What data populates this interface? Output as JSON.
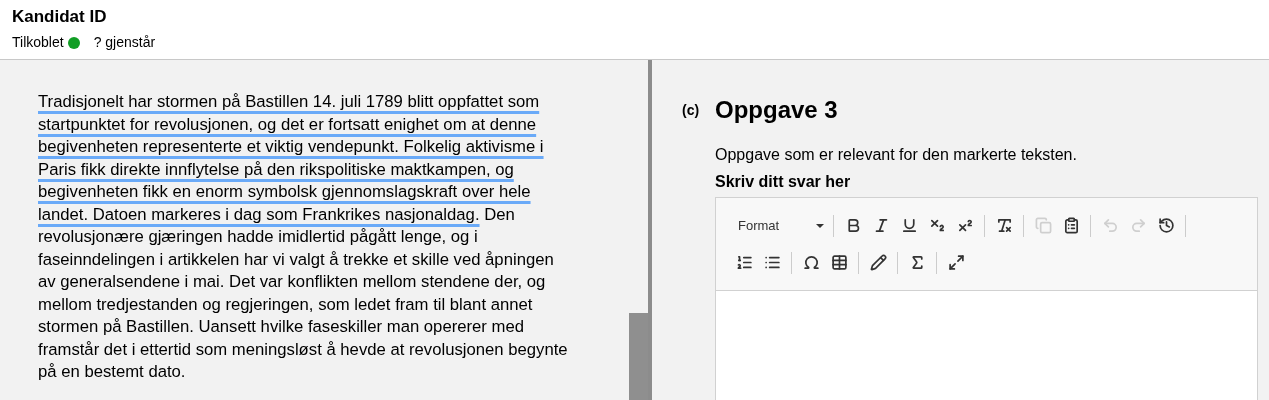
{
  "header": {
    "title": "Kandidat ID",
    "status": {
      "label": "Tilkoblet",
      "connected": true
    },
    "remaining": "? gjenstår"
  },
  "source_text": {
    "segments": [
      {
        "text": "Tradisjonelt har stormen på Bastillen 14. juli 1789 blitt oppfattet som startpunktet for revolusjonen, og det er fortsatt enighet om at denne begivenheten representerte et viktig vendepunkt. Folkelig aktivisme i Paris fikk direkte innflytelse på den rikspolitiske maktkampen, og begivenheten fikk en enorm symbolsk gjennomslagskraft over hele landet. Datoen markeres i dag som Frankrikes nasjonaldag.",
        "marked": true
      },
      {
        "text": " Den revolusjonære gjæringen hadde imidlertid pågått lenge, og i faseinndelingen i artikkelen har vi valgt å trekke et skille ved åpningen av  generalsendene i mai. Det var konflikten mellom stendene der, og mellom tredjestanden og regjeringen, som ledet fram til blant annet stormen på Bastillen. Uansett hvilke faseskiller man opererer med framstår det i ettertid som meningsløst å hevde at revolusjonen begynte på en bestemt dato.",
        "marked": false
      }
    ]
  },
  "task": {
    "number": "(c)",
    "title": "Oppgave 3",
    "description": "Oppgave som er relevant for den markerte teksten.",
    "answer_label": "Skriv ditt svar her",
    "editor": {
      "format": "Format",
      "toolbar_rows": [
        [
          {
            "kind": "bold",
            "disabled": false
          },
          {
            "kind": "italic",
            "disabled": false
          },
          {
            "kind": "underline",
            "disabled": false
          },
          {
            "kind": "subscript",
            "disabled": false
          },
          {
            "kind": "superscript",
            "disabled": false
          },
          {
            "kind": "separator"
          },
          {
            "kind": "clear",
            "disabled": false
          },
          {
            "kind": "separator"
          },
          {
            "kind": "copy",
            "disabled": true
          },
          {
            "kind": "paste",
            "disabled": false
          },
          {
            "kind": "separator"
          },
          {
            "kind": "undo",
            "disabled": true
          },
          {
            "kind": "redo",
            "disabled": true
          },
          {
            "kind": "history",
            "disabled": false
          },
          {
            "kind": "separator"
          }
        ],
        [
          {
            "kind": "numbered",
            "disabled": false
          },
          {
            "kind": "bulleted",
            "disabled": false
          },
          {
            "kind": "separator"
          },
          {
            "kind": "omega",
            "disabled": false
          },
          {
            "kind": "table",
            "disabled": false
          },
          {
            "kind": "separator"
          },
          {
            "kind": "pencil",
            "disabled": false
          },
          {
            "kind": "separator"
          },
          {
            "kind": "sigma",
            "disabled": false
          },
          {
            "kind": "separator"
          },
          {
            "kind": "maximize",
            "disabled": false
          }
        ]
      ]
    }
  }
}
